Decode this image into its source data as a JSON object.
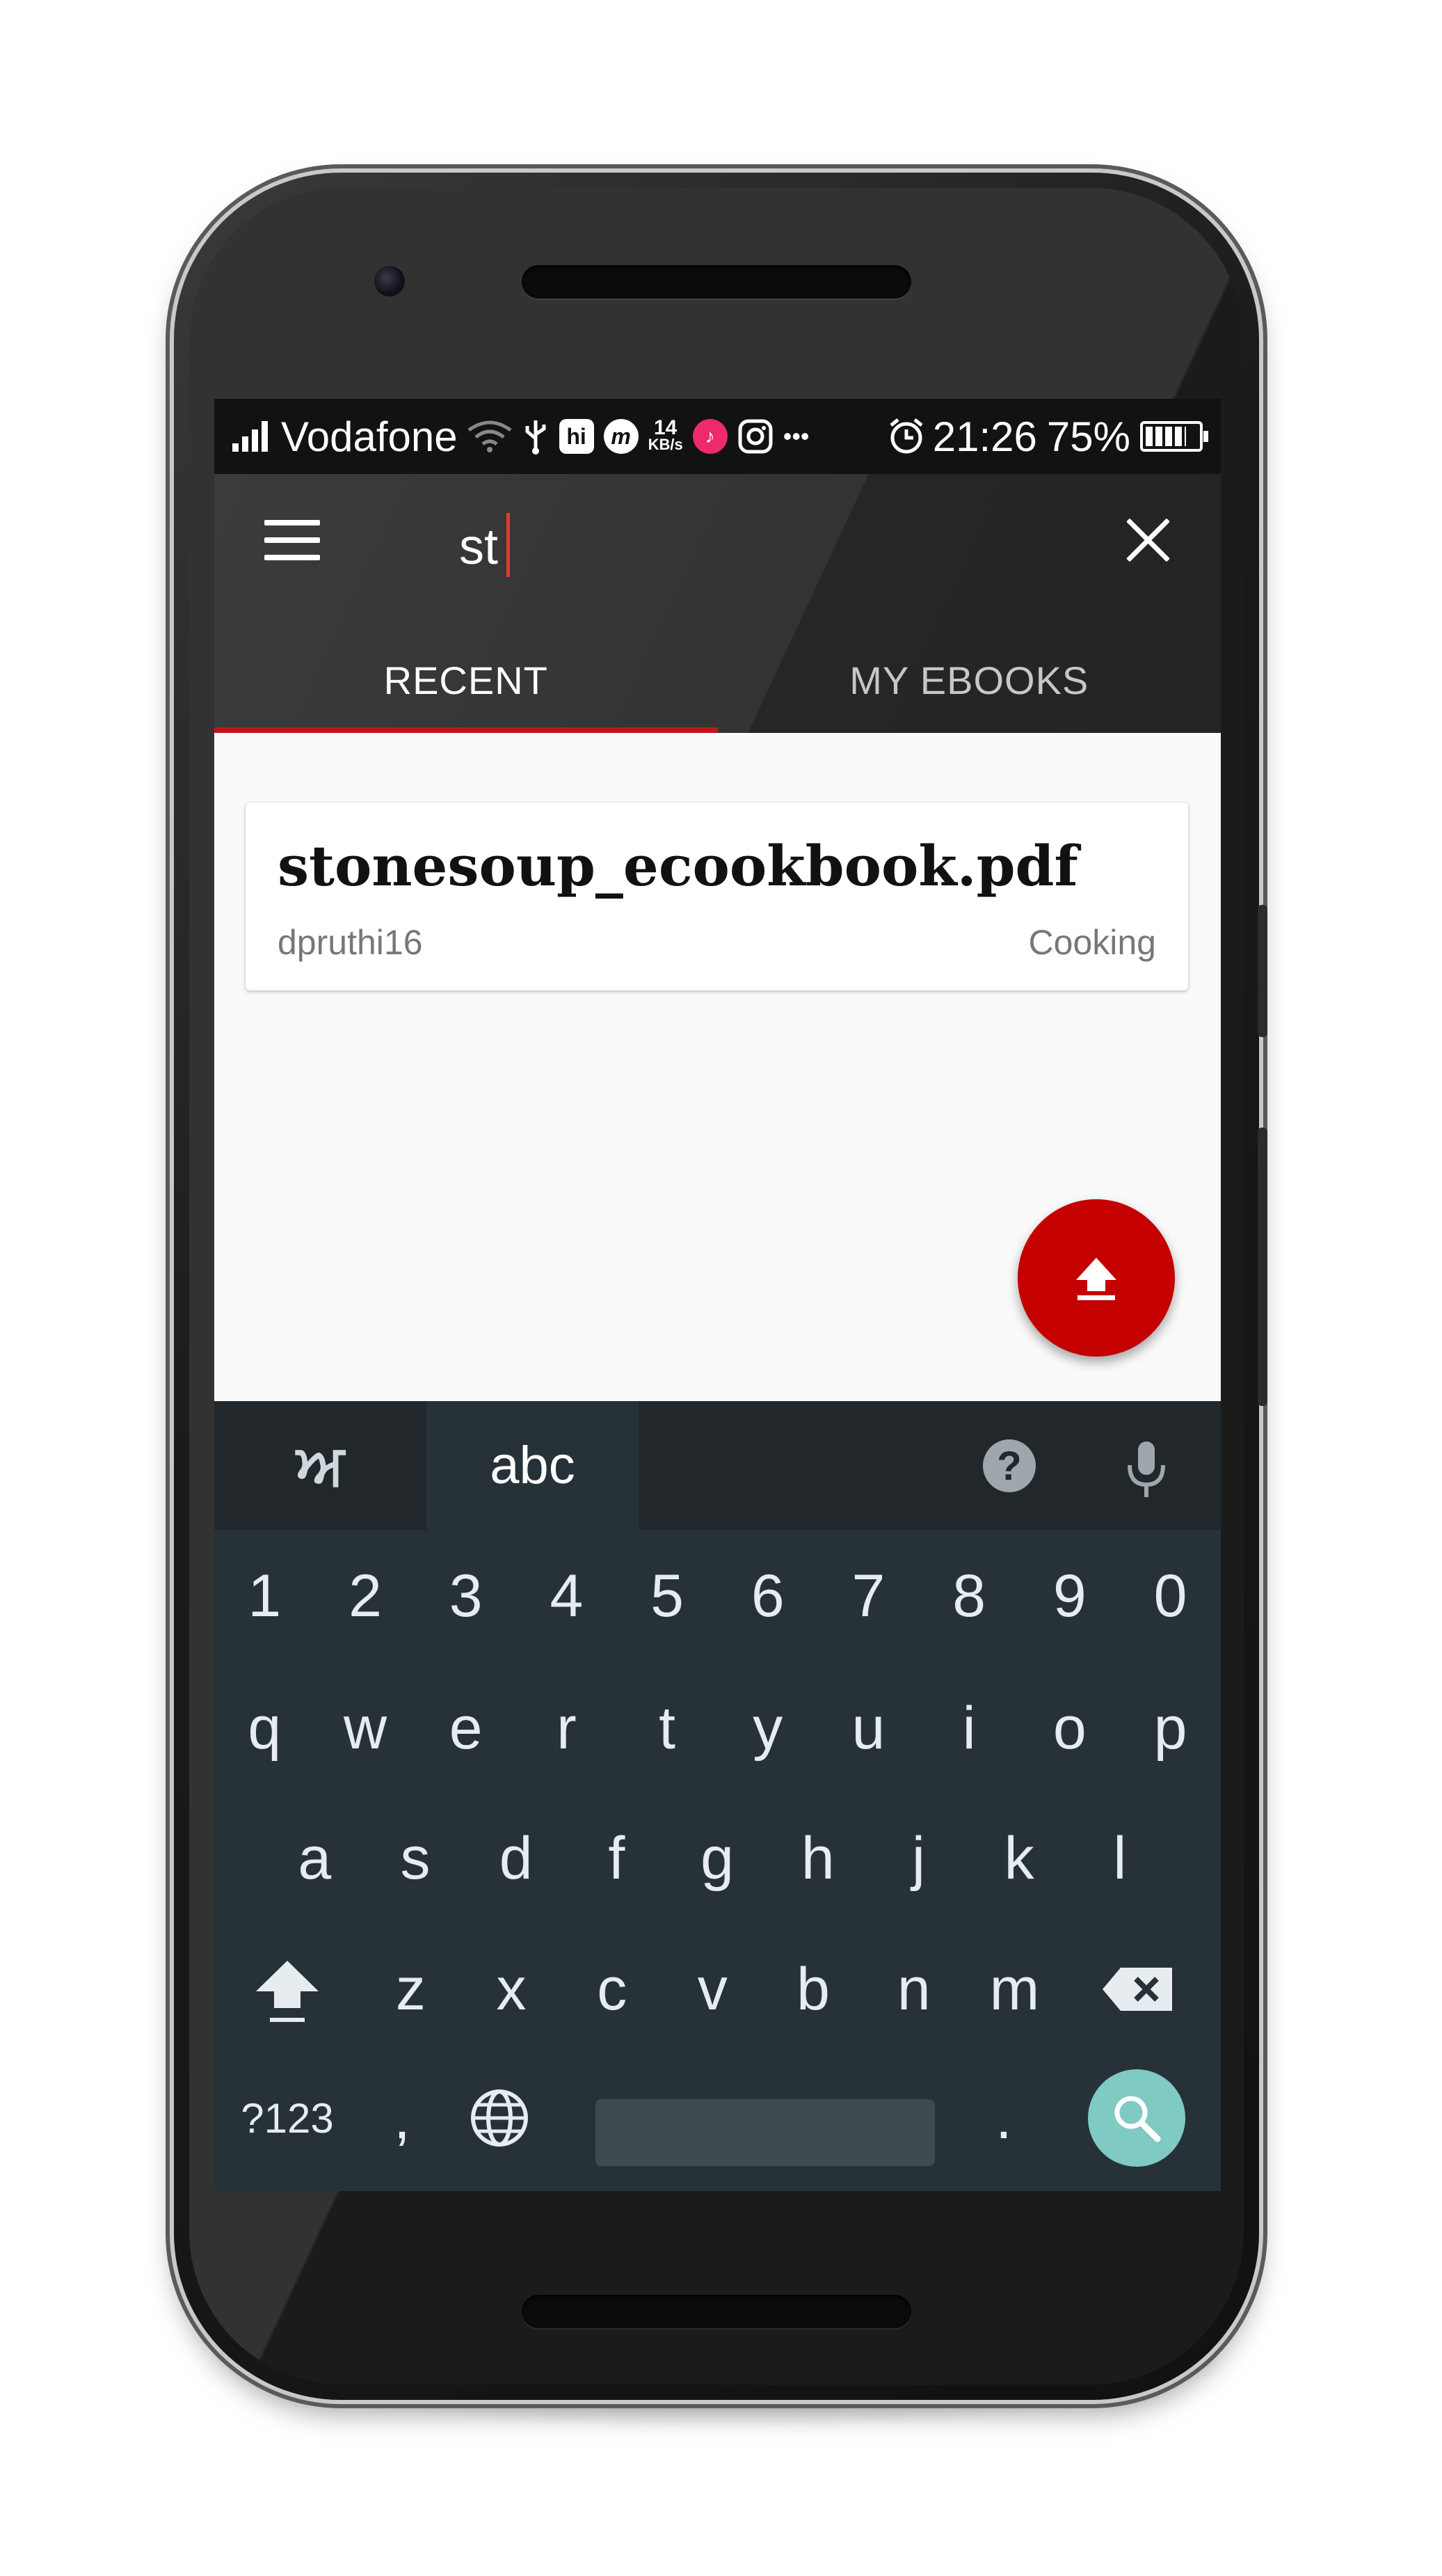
{
  "status_bar": {
    "carrier": "Vodafone",
    "speed_value": "14",
    "speed_unit": "KB/s",
    "hi_icon": "hi",
    "m_icon": "m",
    "more": "•••",
    "time": "21:26",
    "battery": "75%"
  },
  "search": {
    "value": "st"
  },
  "tabs": [
    {
      "label": "RECENT",
      "active": true
    },
    {
      "label": "MY EBOOKS",
      "active": false
    }
  ],
  "results": [
    {
      "title": "stonesoup_ecookbook.pdf",
      "user": "dpruthi16",
      "category": "Cooking"
    }
  ],
  "keyboard": {
    "lang": "ਅ",
    "abc": "abc",
    "help": "?",
    "row_numbers": [
      "1",
      "2",
      "3",
      "4",
      "5",
      "6",
      "7",
      "8",
      "9",
      "0"
    ],
    "row_q": [
      "q",
      "w",
      "e",
      "r",
      "t",
      "y",
      "u",
      "i",
      "o",
      "p"
    ],
    "row_a": [
      "a",
      "s",
      "d",
      "f",
      "g",
      "h",
      "j",
      "k",
      "l"
    ],
    "row_z": [
      "z",
      "x",
      "c",
      "v",
      "b",
      "n",
      "m"
    ],
    "symbols": "?123",
    "comma": ",",
    "period": "."
  },
  "colors": {
    "accent": "#c41418",
    "fab": "#c40000",
    "keyboard_bg": "#263238",
    "search_key": "#7fcac3"
  }
}
